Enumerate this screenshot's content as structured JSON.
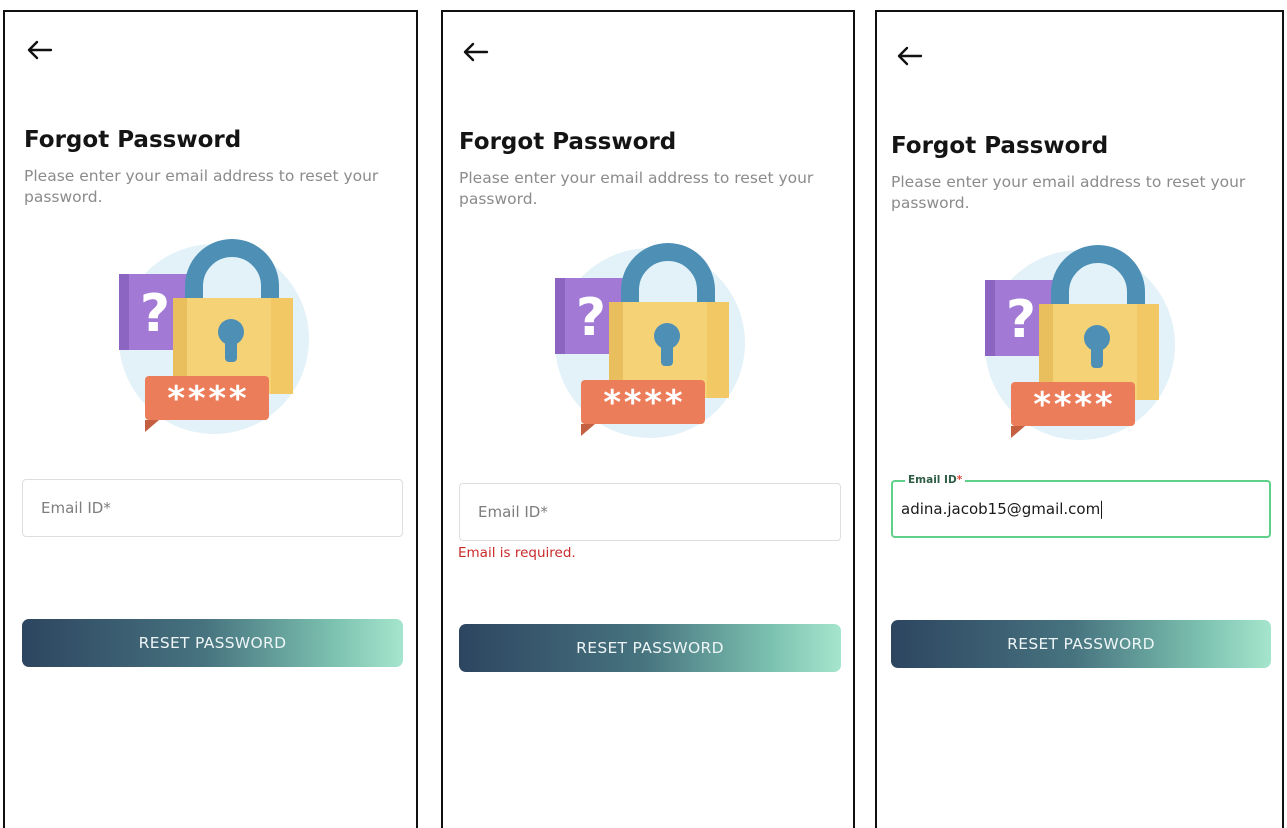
{
  "screens": [
    {
      "title": "Forgot Password",
      "subtitle": "Please enter your email address to reset your password.",
      "email_placeholder": "Email ID*",
      "button_label": "RESET PASSWORD"
    },
    {
      "title": "Forgot Password",
      "subtitle": "Please enter your email address to reset your password.",
      "email_placeholder": "Email ID*",
      "error_text": "Email is required.",
      "button_label": "RESET PASSWORD"
    },
    {
      "title": "Forgot Password",
      "subtitle": "Please enter your email address to reset your password.",
      "email_label": "Email ID",
      "email_required_mark": "*",
      "email_value": "adina.jacob15@gmail.com",
      "button_label": "RESET PASSWORD"
    }
  ],
  "illustration": {
    "mask_text": "****",
    "question_mark": "?"
  },
  "colors": {
    "error": "#c92a2a",
    "focus_border": "#5fd08a",
    "button_gradient_start": "#2d4560",
    "button_gradient_end": "#a6e5cd"
  },
  "icons": {
    "back": "arrow-left-icon",
    "illustration": "padlock-password-icon"
  }
}
